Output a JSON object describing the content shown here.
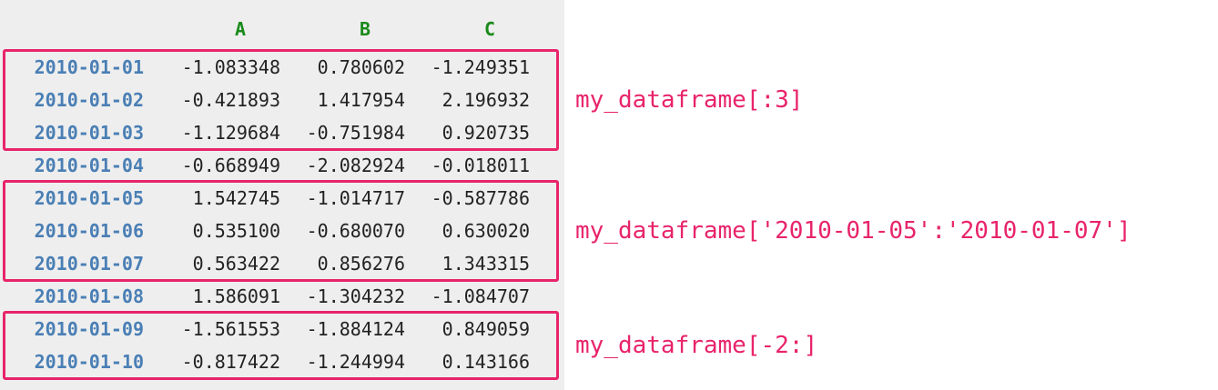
{
  "columns": [
    "A",
    "B",
    "C"
  ],
  "rows": [
    {
      "index": "2010-01-01",
      "a": "-1.083348",
      "b": "0.780602",
      "c": "-1.249351"
    },
    {
      "index": "2010-01-02",
      "a": "-0.421893",
      "b": "1.417954",
      "c": "2.196932"
    },
    {
      "index": "2010-01-03",
      "a": "-1.129684",
      "b": "-0.751984",
      "c": "0.920735"
    },
    {
      "index": "2010-01-04",
      "a": "-0.668949",
      "b": "-2.082924",
      "c": "-0.018011"
    },
    {
      "index": "2010-01-05",
      "a": "1.542745",
      "b": "-1.014717",
      "c": "-0.587786"
    },
    {
      "index": "2010-01-06",
      "a": "0.535100",
      "b": "-0.680070",
      "c": "0.630020"
    },
    {
      "index": "2010-01-07",
      "a": "0.563422",
      "b": "0.856276",
      "c": "1.343315"
    },
    {
      "index": "2010-01-08",
      "a": "1.586091",
      "b": "-1.304232",
      "c": "-1.084707"
    },
    {
      "index": "2010-01-09",
      "a": "-1.561553",
      "b": "-1.884124",
      "c": "0.849059"
    },
    {
      "index": "2010-01-10",
      "a": "-0.817422",
      "b": "-1.244994",
      "c": "0.143166"
    }
  ],
  "selections": [
    {
      "label": "my_dataframe[:3]",
      "first_row": 0,
      "last_row": 2
    },
    {
      "label": "my_dataframe['2010-01-05':'2010-01-07']",
      "first_row": 4,
      "last_row": 6
    },
    {
      "label": "my_dataframe[-2:]",
      "first_row": 8,
      "last_row": 9
    }
  ],
  "colors": {
    "column_header": "#1a8a1a",
    "index": "#4a7fb5",
    "highlight": "#e8246b",
    "panel_background": "#eeeeee"
  }
}
